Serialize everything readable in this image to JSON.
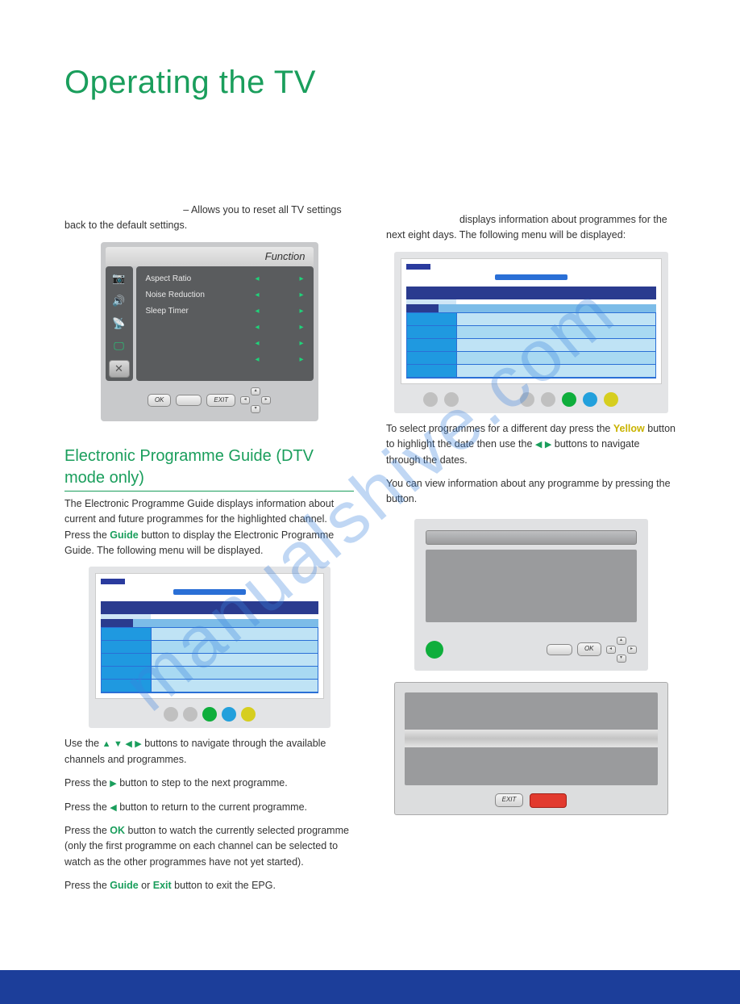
{
  "page_title": "Operating the TV",
  "watermark": "manualshive.com",
  "left": {
    "reset": {
      "lead": " – Allows you to reset all TV settings back to the default settings."
    },
    "function_menu": {
      "title": "Function",
      "items": [
        "Aspect Ratio",
        "Noise Reduction",
        "Sleep Timer"
      ],
      "ok": "OK",
      "exit": "EXIT"
    },
    "epg_heading": "Electronic Programme Guide (DTV mode only)",
    "p1_a": "The Electronic Programme Guide displays information about current and future programmes for the highlighted channel. Press the ",
    "p1_guide": "Guide",
    "p1_b": " button to display the Electronic Programme Guide. The following menu will be displayed.",
    "p2_a": "Use the ",
    "p2_b": " buttons to navigate through the available channels and programmes.",
    "p3_a": "Press the ",
    "p3_b": " button to step to the next programme.",
    "p4_a": "Press the ",
    "p4_b": " button to return to the current programme.",
    "p5_a": "Press the ",
    "p5_ok": "OK",
    "p5_b": " button to watch the currently selected programme (only the first programme on each channel can be selected to watch as the other programmes have not yet started).",
    "p6_a": "Press the ",
    "p6_guide": "Guide",
    "p6_or": " or ",
    "p6_exit": "Exit",
    "p6_b": " button to exit the EPG."
  },
  "right": {
    "p1": " displays information about programmes for the next eight days. The following menu will be displayed:",
    "p2_a": "To select programmes for a different day press the ",
    "p2_yellow": "Yellow",
    "p2_b": " button to highlight the date then use the ",
    "p2_c": " buttons to navigate through the dates.",
    "p3": "You can view information about any programme by pressing the          button.",
    "ok_panel": {
      "ok": "OK"
    },
    "exit_panel": {
      "exit": "EXIT"
    }
  },
  "arrows": {
    "up": "▲",
    "down": "▼",
    "left": "◀",
    "right": "▶"
  }
}
